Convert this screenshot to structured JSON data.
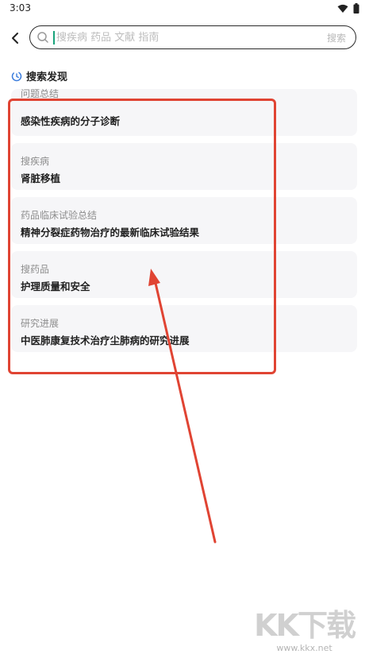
{
  "status_bar": {
    "time": "3:03",
    "icons": [
      "wifi-icon",
      "battery-icon"
    ]
  },
  "search": {
    "back_icon": "chevron-left-icon",
    "search_icon": "search-icon",
    "value": "",
    "placeholder": "搜疾病 药品 文献 指南",
    "submit_label": "搜索"
  },
  "discover": {
    "icon": "clock-icon",
    "title": "搜索发现",
    "items": [
      {
        "label": "问题总结",
        "title": "感染性疾病的分子诊断"
      },
      {
        "label": "搜疾病",
        "title": "肾脏移植"
      },
      {
        "label": "药品临床试验总结",
        "title": "精神分裂症药物治疗的最新临床试验结果"
      },
      {
        "label": "搜药品",
        "title": "护理质量和安全"
      },
      {
        "label": "研究进展",
        "title": "中医肺康复技术治疗尘肺病的研究进展"
      }
    ]
  },
  "annotation": {
    "color": "#e04433"
  },
  "watermark": {
    "logo": "KK下载",
    "url": "www.kkx.net"
  },
  "colors": {
    "accent": "#19a37b",
    "clock_icon": "#3b7ddd",
    "card_bg": "#f6f6f8"
  }
}
